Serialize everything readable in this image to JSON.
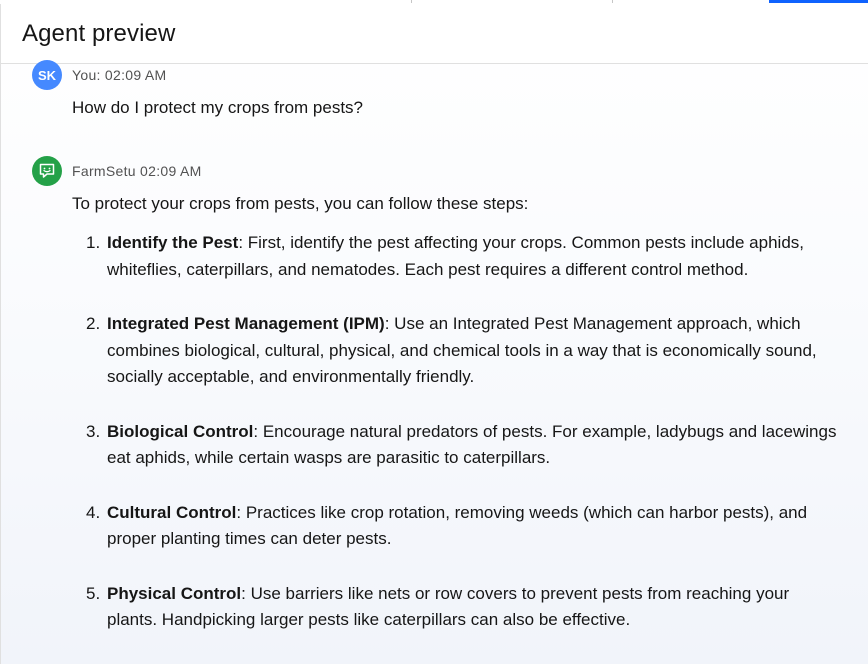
{
  "header": {
    "title": "Agent preview"
  },
  "user_message": {
    "avatar_initials": "SK",
    "meta": "You: 02:09 AM",
    "text": "How do I protect my crops from pests?"
  },
  "bot_message": {
    "avatar_icon": "chat-bot-icon",
    "meta": "FarmSetu 02:09 AM",
    "intro": "To protect your crops from pests, you can follow these steps:",
    "steps": [
      {
        "number": "1.",
        "title": "Identify the Pest",
        "body": ": First, identify the pest affecting your crops. Common pests include aphids, whiteflies, caterpillars, and nematodes. Each pest requires a different control method."
      },
      {
        "number": "2.",
        "title": "Integrated Pest Management (IPM)",
        "body": ": Use an Integrated Pest Management approach, which combines biological, cultural, physical, and chemical tools in a way that is economically sound, socially acceptable, and environmentally friendly."
      },
      {
        "number": "3.",
        "title": "Biological Control",
        "body": ": Encourage natural predators of pests. For example, ladybugs and lacewings eat aphids, while certain wasps are parasitic to caterpillars."
      },
      {
        "number": "4.",
        "title": "Cultural Control",
        "body": ": Practices like crop rotation, removing weeds (which can harbor pests), and proper planting times can deter pests."
      },
      {
        "number": "5.",
        "title": "Physical Control",
        "body": ": Use barriers like nets or row covers to prevent pests from reaching your plants. Handpicking larger pests like caterpillars can also be effective."
      }
    ]
  },
  "colors": {
    "accent": "#0f62fe",
    "user_avatar": "#4589ff",
    "bot_avatar": "#24a148"
  }
}
